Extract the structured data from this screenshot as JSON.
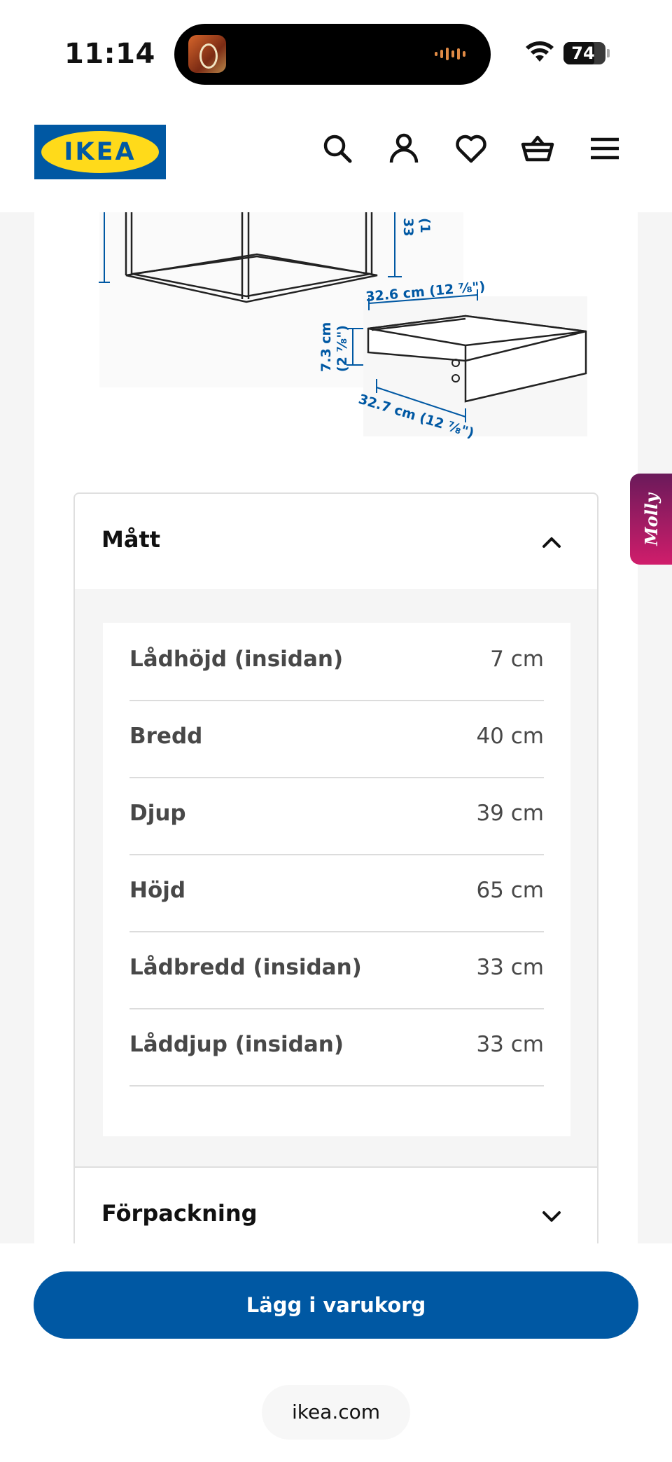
{
  "status_bar": {
    "time": "11:14",
    "battery": "74",
    "battery_level": 0.74
  },
  "header": {
    "logo_text": "IKEA",
    "icons": [
      "search-icon",
      "account-icon",
      "heart-icon",
      "basket-icon",
      "menu-icon"
    ]
  },
  "drawing": {
    "height_partial": "33",
    "height_partial_in": "(1",
    "drawer_width": "32.6 cm (12 ⁷⁄₈\")",
    "drawer_height_cm": "7.3 cm",
    "drawer_height_in": "(2 ⁷⁄₈\")",
    "drawer_depth": "32.7 cm (12 ⁷⁄₈\")"
  },
  "dimensions": {
    "title": "Mått",
    "rows": [
      {
        "label": "Lådhöjd (insidan)",
        "value": "7 cm"
      },
      {
        "label": "Bredd",
        "value": "40 cm"
      },
      {
        "label": "Djup",
        "value": "39 cm"
      },
      {
        "label": "Höjd",
        "value": "65 cm"
      },
      {
        "label": "Lådbredd (insidan)",
        "value": "33 cm"
      },
      {
        "label": "Låddjup (insidan)",
        "value": "33 cm"
      }
    ]
  },
  "packaging": {
    "title": "Förpackning"
  },
  "chat_tab": {
    "label": "Molly"
  },
  "cta": {
    "label": "Lägg i varukorg"
  },
  "browser": {
    "url": "ikea.com"
  },
  "colors": {
    "brand_blue": "#0058a3",
    "brand_yellow": "#ffda1a",
    "molly_gradient_start": "#6a1a5a",
    "molly_gradient_end": "#d01d6b"
  }
}
